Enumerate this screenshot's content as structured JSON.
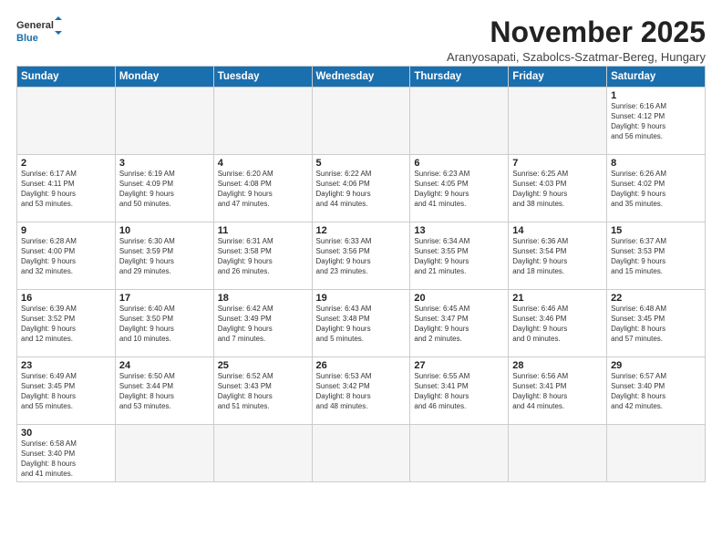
{
  "logo": {
    "text_general": "General",
    "text_blue": "Blue"
  },
  "title": "November 2025",
  "subtitle": "Aranyosapati, Szabolcs-Szatmar-Bereg, Hungary",
  "days_of_week": [
    "Sunday",
    "Monday",
    "Tuesday",
    "Wednesday",
    "Thursday",
    "Friday",
    "Saturday"
  ],
  "weeks": [
    [
      {
        "num": "",
        "info": "",
        "empty": true
      },
      {
        "num": "",
        "info": "",
        "empty": true
      },
      {
        "num": "",
        "info": "",
        "empty": true
      },
      {
        "num": "",
        "info": "",
        "empty": true
      },
      {
        "num": "",
        "info": "",
        "empty": true
      },
      {
        "num": "",
        "info": "",
        "empty": true
      },
      {
        "num": "1",
        "info": "Sunrise: 6:16 AM\nSunset: 4:12 PM\nDaylight: 9 hours\nand 56 minutes."
      }
    ],
    [
      {
        "num": "2",
        "info": "Sunrise: 6:17 AM\nSunset: 4:11 PM\nDaylight: 9 hours\nand 53 minutes."
      },
      {
        "num": "3",
        "info": "Sunrise: 6:19 AM\nSunset: 4:09 PM\nDaylight: 9 hours\nand 50 minutes."
      },
      {
        "num": "4",
        "info": "Sunrise: 6:20 AM\nSunset: 4:08 PM\nDaylight: 9 hours\nand 47 minutes."
      },
      {
        "num": "5",
        "info": "Sunrise: 6:22 AM\nSunset: 4:06 PM\nDaylight: 9 hours\nand 44 minutes."
      },
      {
        "num": "6",
        "info": "Sunrise: 6:23 AM\nSunset: 4:05 PM\nDaylight: 9 hours\nand 41 minutes."
      },
      {
        "num": "7",
        "info": "Sunrise: 6:25 AM\nSunset: 4:03 PM\nDaylight: 9 hours\nand 38 minutes."
      },
      {
        "num": "8",
        "info": "Sunrise: 6:26 AM\nSunset: 4:02 PM\nDaylight: 9 hours\nand 35 minutes."
      }
    ],
    [
      {
        "num": "9",
        "info": "Sunrise: 6:28 AM\nSunset: 4:00 PM\nDaylight: 9 hours\nand 32 minutes."
      },
      {
        "num": "10",
        "info": "Sunrise: 6:30 AM\nSunset: 3:59 PM\nDaylight: 9 hours\nand 29 minutes."
      },
      {
        "num": "11",
        "info": "Sunrise: 6:31 AM\nSunset: 3:58 PM\nDaylight: 9 hours\nand 26 minutes."
      },
      {
        "num": "12",
        "info": "Sunrise: 6:33 AM\nSunset: 3:56 PM\nDaylight: 9 hours\nand 23 minutes."
      },
      {
        "num": "13",
        "info": "Sunrise: 6:34 AM\nSunset: 3:55 PM\nDaylight: 9 hours\nand 21 minutes."
      },
      {
        "num": "14",
        "info": "Sunrise: 6:36 AM\nSunset: 3:54 PM\nDaylight: 9 hours\nand 18 minutes."
      },
      {
        "num": "15",
        "info": "Sunrise: 6:37 AM\nSunset: 3:53 PM\nDaylight: 9 hours\nand 15 minutes."
      }
    ],
    [
      {
        "num": "16",
        "info": "Sunrise: 6:39 AM\nSunset: 3:52 PM\nDaylight: 9 hours\nand 12 minutes."
      },
      {
        "num": "17",
        "info": "Sunrise: 6:40 AM\nSunset: 3:50 PM\nDaylight: 9 hours\nand 10 minutes."
      },
      {
        "num": "18",
        "info": "Sunrise: 6:42 AM\nSunset: 3:49 PM\nDaylight: 9 hours\nand 7 minutes."
      },
      {
        "num": "19",
        "info": "Sunrise: 6:43 AM\nSunset: 3:48 PM\nDaylight: 9 hours\nand 5 minutes."
      },
      {
        "num": "20",
        "info": "Sunrise: 6:45 AM\nSunset: 3:47 PM\nDaylight: 9 hours\nand 2 minutes."
      },
      {
        "num": "21",
        "info": "Sunrise: 6:46 AM\nSunset: 3:46 PM\nDaylight: 9 hours\nand 0 minutes."
      },
      {
        "num": "22",
        "info": "Sunrise: 6:48 AM\nSunset: 3:45 PM\nDaylight: 8 hours\nand 57 minutes."
      }
    ],
    [
      {
        "num": "23",
        "info": "Sunrise: 6:49 AM\nSunset: 3:45 PM\nDaylight: 8 hours\nand 55 minutes."
      },
      {
        "num": "24",
        "info": "Sunrise: 6:50 AM\nSunset: 3:44 PM\nDaylight: 8 hours\nand 53 minutes."
      },
      {
        "num": "25",
        "info": "Sunrise: 6:52 AM\nSunset: 3:43 PM\nDaylight: 8 hours\nand 51 minutes."
      },
      {
        "num": "26",
        "info": "Sunrise: 6:53 AM\nSunset: 3:42 PM\nDaylight: 8 hours\nand 48 minutes."
      },
      {
        "num": "27",
        "info": "Sunrise: 6:55 AM\nSunset: 3:41 PM\nDaylight: 8 hours\nand 46 minutes."
      },
      {
        "num": "28",
        "info": "Sunrise: 6:56 AM\nSunset: 3:41 PM\nDaylight: 8 hours\nand 44 minutes."
      },
      {
        "num": "29",
        "info": "Sunrise: 6:57 AM\nSunset: 3:40 PM\nDaylight: 8 hours\nand 42 minutes."
      }
    ],
    [
      {
        "num": "30",
        "info": "Sunrise: 6:58 AM\nSunset: 3:40 PM\nDaylight: 8 hours\nand 41 minutes."
      },
      {
        "num": "",
        "info": "",
        "empty": true
      },
      {
        "num": "",
        "info": "",
        "empty": true
      },
      {
        "num": "",
        "info": "",
        "empty": true
      },
      {
        "num": "",
        "info": "",
        "empty": true
      },
      {
        "num": "",
        "info": "",
        "empty": true
      },
      {
        "num": "",
        "info": "",
        "empty": true
      }
    ]
  ]
}
